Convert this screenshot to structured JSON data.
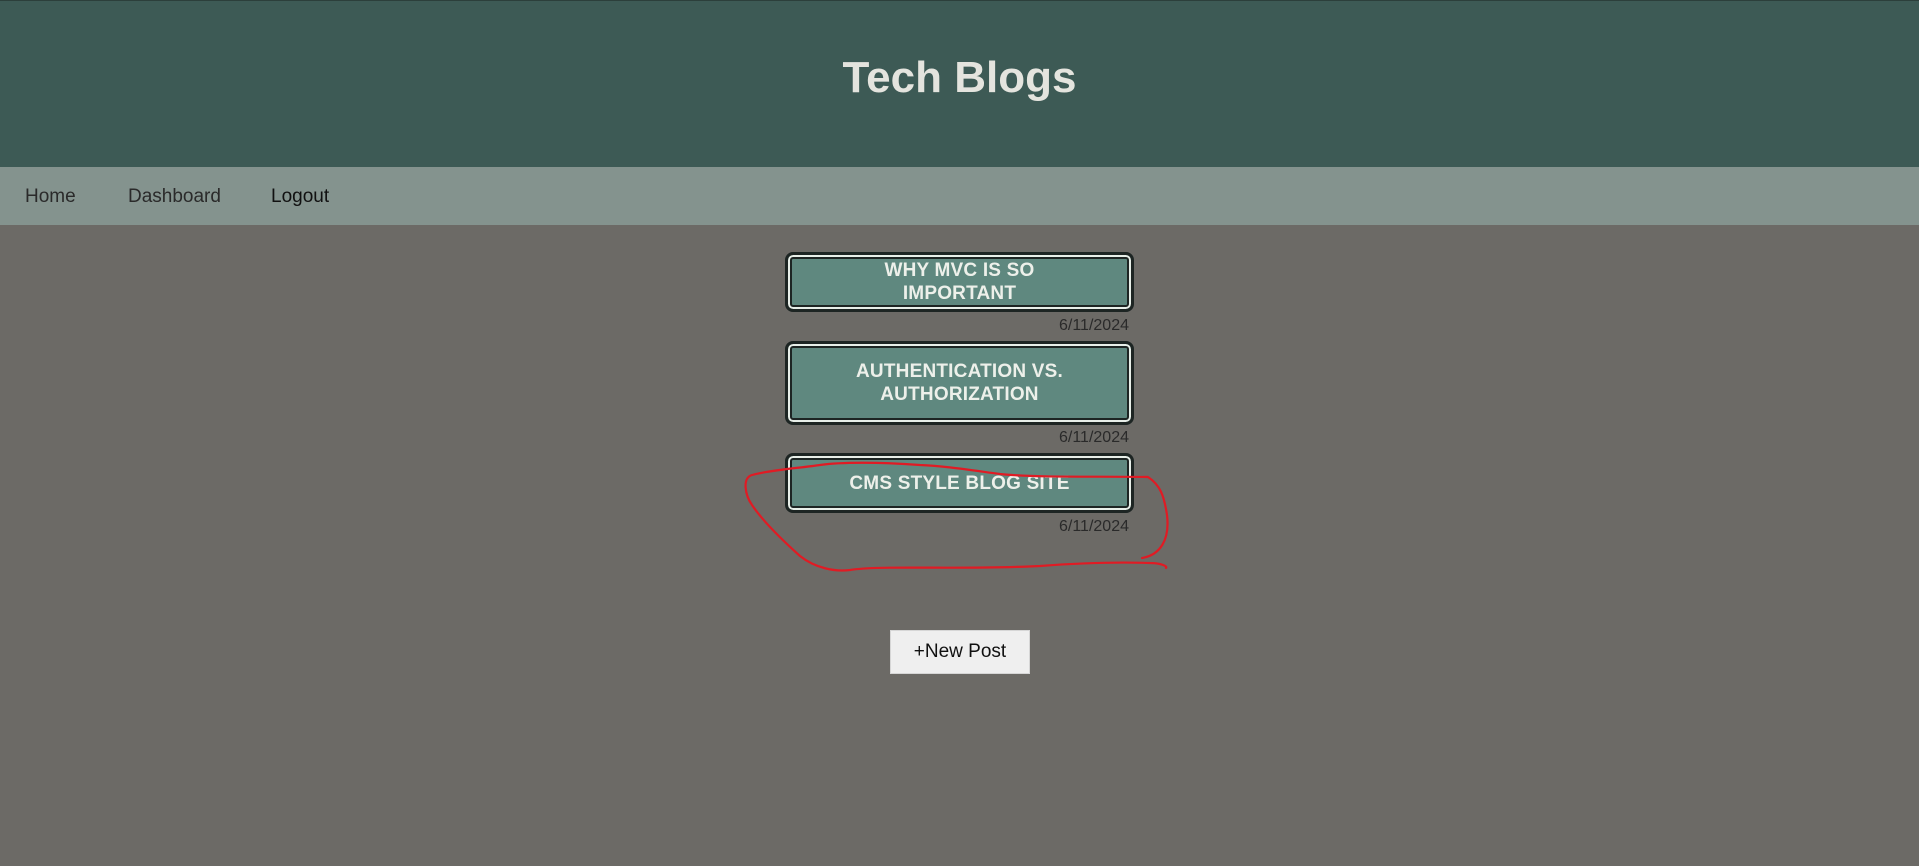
{
  "header": {
    "title": "Tech Blogs"
  },
  "nav": {
    "items": [
      {
        "label": "Home"
      },
      {
        "label": "Dashboard"
      },
      {
        "label": "Logout"
      }
    ]
  },
  "posts": [
    {
      "title": "WHY MVC IS SO IMPORTANT",
      "date": "6/11/2024"
    },
    {
      "title": "AUTHENTICATION VS. AUTHORIZATION",
      "date": "6/11/2024"
    },
    {
      "title": "CMS STYLE BLOG SITE",
      "date": "6/11/2024"
    }
  ],
  "actions": {
    "new_post_label": "+New Post"
  },
  "colors": {
    "header_bg": "#3d5a55",
    "nav_bg": "#84938e",
    "page_bg": "#6c6a66",
    "post_bg": "#5f887f",
    "annotation": "#e01b24"
  }
}
